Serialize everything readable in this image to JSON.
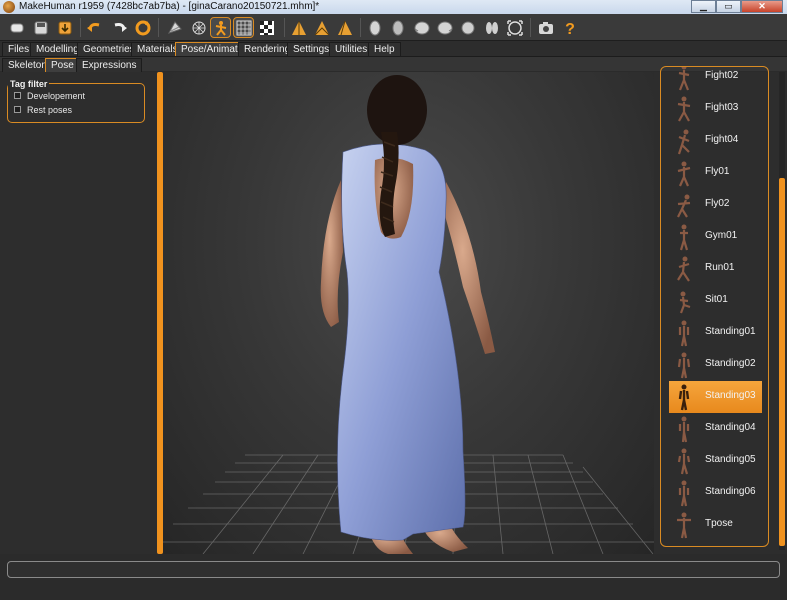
{
  "window": {
    "title": "MakeHuman r1959 (7428bc7ab7ba) - [ginaCarano20150721.mhm]*",
    "minimize_label": "▁",
    "maximize_label": "▭",
    "close_label": "✕"
  },
  "toolbar": {
    "groups": [
      {
        "icons": [
          "undo-icon",
          "redo-icon",
          "reset-icon"
        ]
      },
      {
        "icons": [
          "smooth-icon",
          "wireframe-icon",
          "pose-icon",
          "grid-icon",
          "background-icon"
        ]
      },
      {
        "icons": [
          "front-view-icon",
          "back-view-icon",
          "side-view-icon"
        ]
      },
      {
        "icons": [
          "camera-icon",
          "help-icon"
        ]
      }
    ],
    "active_icons": [
      "pose-icon",
      "grid-icon"
    ],
    "accent": "#d98b23"
  },
  "menu": {
    "tabs": [
      "Files",
      "Modelling",
      "Geometries",
      "Materials",
      "Pose/Animate",
      "Rendering",
      "Settings",
      "Utilities",
      "Help"
    ],
    "active": "Pose/Animate"
  },
  "subtabs": {
    "tabs": [
      "Skeleton",
      "Pose",
      "Expressions"
    ],
    "active": "Pose"
  },
  "tag_filter": {
    "title": "Tag filter",
    "options": [
      {
        "label": "Developement",
        "checked": false
      },
      {
        "label": "Rest poses",
        "checked": false
      }
    ]
  },
  "poses": {
    "items": [
      "Fight02",
      "Fight03",
      "Fight04",
      "Fly01",
      "Fly02",
      "Gym01",
      "Run01",
      "Sit01",
      "Standing01",
      "Standing02",
      "Standing03",
      "Standing04",
      "Standing05",
      "Standing06",
      "Tpose"
    ],
    "selected": "Standing03",
    "selected_color": "#f09a2c"
  },
  "status": {
    "message": ""
  }
}
